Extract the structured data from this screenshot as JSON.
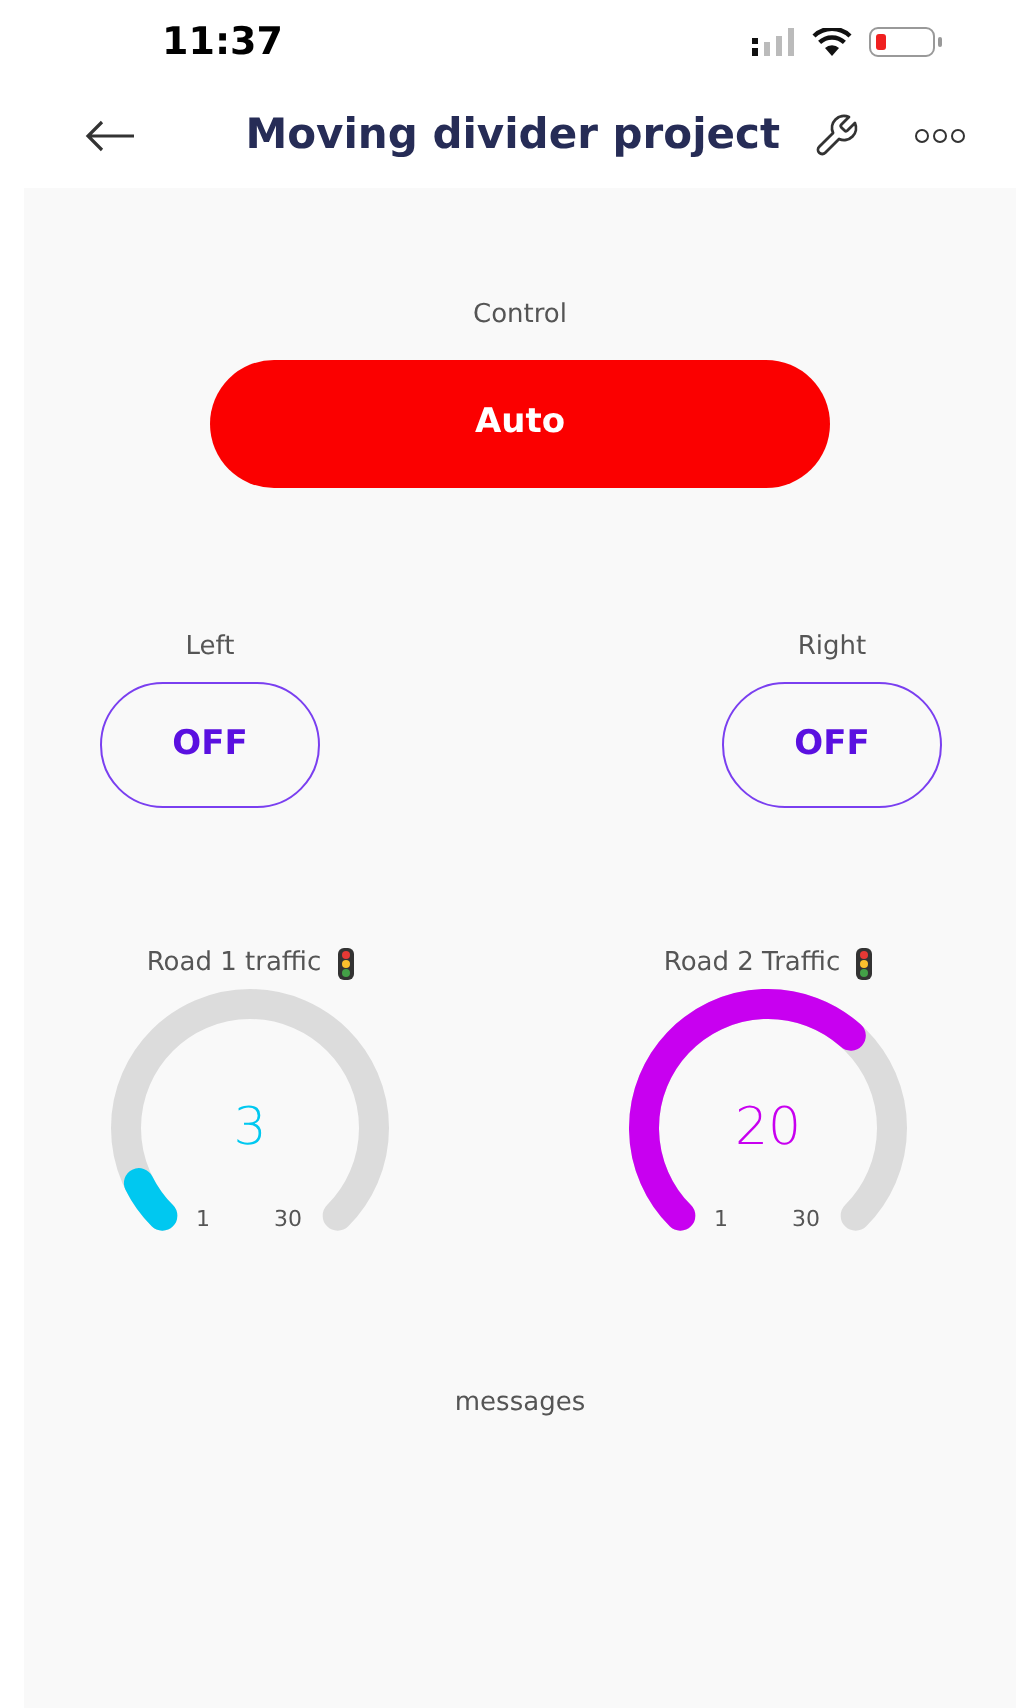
{
  "status_bar": {
    "time": "11:37"
  },
  "header": {
    "title": "Moving divider project"
  },
  "control": {
    "label": "Control",
    "button": "Auto"
  },
  "switches": [
    {
      "label": "Left",
      "value": "OFF",
      "on": false
    },
    {
      "label": "Right",
      "value": "OFF",
      "on": false
    }
  ],
  "gauges": [
    {
      "label": "Road 1 traffic",
      "value": "3",
      "min": "1",
      "max": "30",
      "color": "#00c8f0"
    },
    {
      "label": "Road 2 Traffic",
      "value": "20",
      "min": "1",
      "max": "30",
      "color": "#c800f0"
    }
  ],
  "messages": {
    "label": "messages"
  }
}
